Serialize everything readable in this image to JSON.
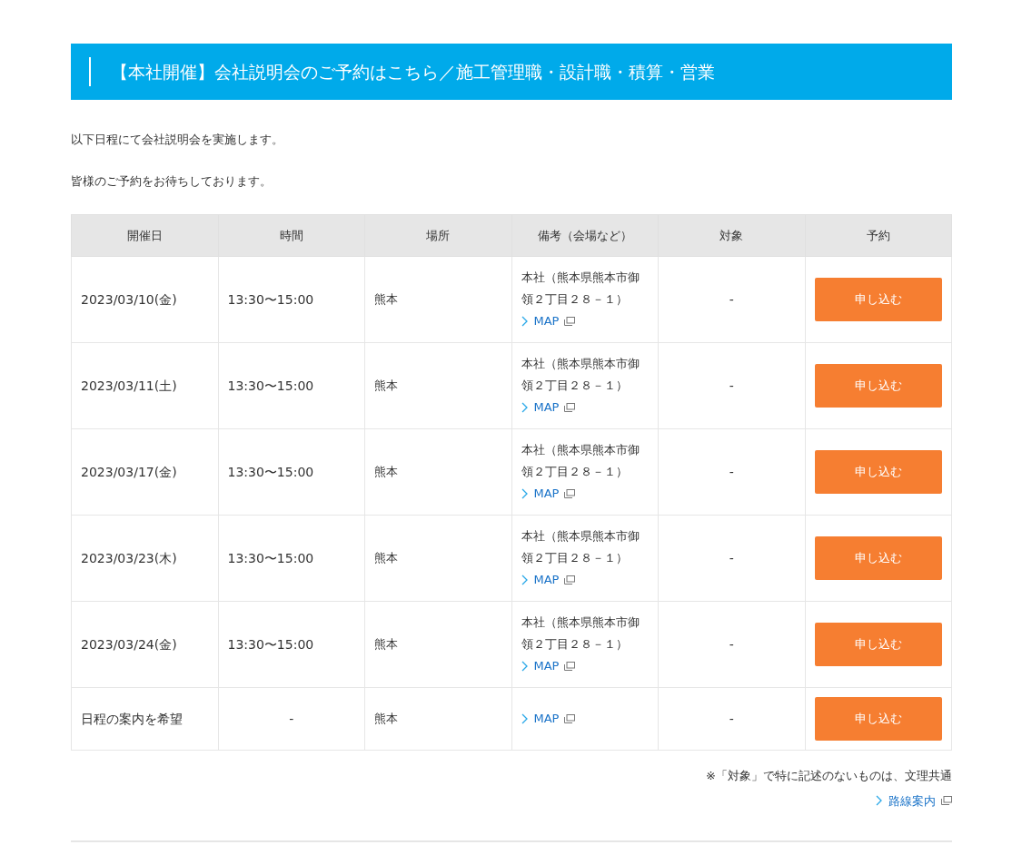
{
  "heading": "【本社開催】会社説明会のご予約はこちら／施工管理職・設計職・積算・営業",
  "intro": [
    "以下日程にて会社説明会を実施します。",
    "皆様のご予約をお待ちしております。"
  ],
  "table": {
    "columns": [
      "開催日",
      "時間",
      "場所",
      "備考（会場など）",
      "対象",
      "予約"
    ],
    "rows": [
      {
        "date": "2023/03/10(金)",
        "time": "13:30〜15:00",
        "place": "熊本",
        "note": "本社（熊本県熊本市御領２丁目２８－１）",
        "map": "MAP",
        "target": "-",
        "button": "申し込む"
      },
      {
        "date": "2023/03/11(土)",
        "time": "13:30〜15:00",
        "place": "熊本",
        "note": "本社（熊本県熊本市御領２丁目２８－１）",
        "map": "MAP",
        "target": "-",
        "button": "申し込む"
      },
      {
        "date": "2023/03/17(金)",
        "time": "13:30〜15:00",
        "place": "熊本",
        "note": "本社（熊本県熊本市御領２丁目２８－１）",
        "map": "MAP",
        "target": "-",
        "button": "申し込む"
      },
      {
        "date": "2023/03/23(木)",
        "time": "13:30〜15:00",
        "place": "熊本",
        "note": "本社（熊本県熊本市御領２丁目２８－１）",
        "map": "MAP",
        "target": "-",
        "button": "申し込む"
      },
      {
        "date": "2023/03/24(金)",
        "time": "13:30〜15:00",
        "place": "熊本",
        "note": "本社（熊本県熊本市御領２丁目２８－１）",
        "map": "MAP",
        "target": "-",
        "button": "申し込む"
      },
      {
        "date": "日程の案内を希望",
        "time": "-",
        "place": "熊本",
        "map": "MAP",
        "target": "-",
        "button": "申し込む"
      }
    ]
  },
  "footnote": "※「対象」で特に記述のないものは、文理共通",
  "route_link": "路線案内"
}
